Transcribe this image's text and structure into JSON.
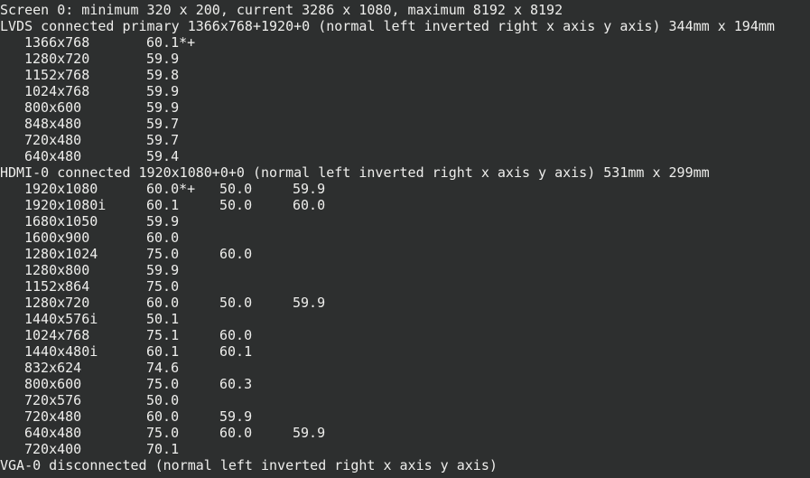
{
  "colors": {
    "background": "#2d2f2f",
    "foreground": "#eeeeec",
    "prompt_user": "#8ae234",
    "prompt_path": "#729fcf"
  },
  "screen_line": "Screen 0: minimum 320 x 200, current 3286 x 1080, maximum 8192 x 8192",
  "outputs": [
    {
      "header": "LVDS connected primary 1366x768+1920+0 (normal left inverted right x axis y axis) 344mm x 194mm",
      "modes": [
        {
          "res": "1366x768",
          "rates": [
            "60.1*+"
          ]
        },
        {
          "res": "1280x720",
          "rates": [
            "59.9"
          ]
        },
        {
          "res": "1152x768",
          "rates": [
            "59.8"
          ]
        },
        {
          "res": "1024x768",
          "rates": [
            "59.9"
          ]
        },
        {
          "res": "800x600",
          "rates": [
            "59.9"
          ]
        },
        {
          "res": "848x480",
          "rates": [
            "59.7"
          ]
        },
        {
          "res": "720x480",
          "rates": [
            "59.7"
          ]
        },
        {
          "res": "640x480",
          "rates": [
            "59.4"
          ]
        }
      ]
    },
    {
      "header": "HDMI-0 connected 1920x1080+0+0 (normal left inverted right x axis y axis) 531mm x 299mm",
      "modes": [
        {
          "res": "1920x1080",
          "rates": [
            "60.0*+",
            "50.0",
            "59.9"
          ]
        },
        {
          "res": "1920x1080i",
          "rates": [
            "60.1",
            "50.0",
            "60.0"
          ]
        },
        {
          "res": "1680x1050",
          "rates": [
            "59.9"
          ]
        },
        {
          "res": "1600x900",
          "rates": [
            "60.0"
          ]
        },
        {
          "res": "1280x1024",
          "rates": [
            "75.0",
            "60.0"
          ]
        },
        {
          "res": "1280x800",
          "rates": [
            "59.9"
          ]
        },
        {
          "res": "1152x864",
          "rates": [
            "75.0"
          ]
        },
        {
          "res": "1280x720",
          "rates": [
            "60.0",
            "50.0",
            "59.9"
          ]
        },
        {
          "res": "1440x576i",
          "rates": [
            "50.1"
          ]
        },
        {
          "res": "1024x768",
          "rates": [
            "75.1",
            "60.0"
          ]
        },
        {
          "res": "1440x480i",
          "rates": [
            "60.1",
            "60.1"
          ]
        },
        {
          "res": "832x624",
          "rates": [
            "74.6"
          ]
        },
        {
          "res": "800x600",
          "rates": [
            "75.0",
            "60.3"
          ]
        },
        {
          "res": "720x576",
          "rates": [
            "50.0"
          ]
        },
        {
          "res": "720x480",
          "rates": [
            "60.0",
            "59.9"
          ]
        },
        {
          "res": "640x480",
          "rates": [
            "75.0",
            "60.0",
            "59.9"
          ]
        },
        {
          "res": "720x400",
          "rates": [
            "70.1"
          ]
        }
      ]
    },
    {
      "header": "VGA-0 disconnected (normal left inverted right x axis y axis)",
      "modes": []
    }
  ]
}
